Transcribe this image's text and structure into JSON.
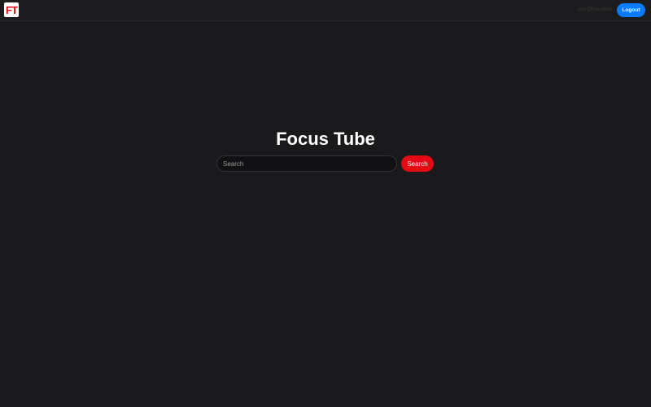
{
  "header": {
    "logo_text": "FT",
    "user_email": "user@focustube",
    "logout_label": "Logout"
  },
  "main": {
    "title": "Focus Tube",
    "search": {
      "value": "",
      "placeholder": "Search",
      "button_label": "Search"
    }
  },
  "colors": {
    "background": "#1a1a1c",
    "brand_red": "#e50914",
    "logout_blue": "#0a7aff"
  }
}
